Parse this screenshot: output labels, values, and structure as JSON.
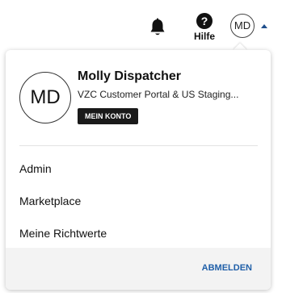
{
  "header": {
    "help_icon_glyph": "?",
    "help_label": "Hilfe",
    "avatar_initials": "MD",
    "icons": [
      "bell-icon",
      "help-icon",
      "caret-up-icon"
    ],
    "accent_color": "#1f4e8c"
  },
  "profile_menu": {
    "avatar_initials": "MD",
    "user_name": "Molly Dispatcher",
    "organization": "VZC Customer Portal & US Staging...",
    "account_button_label": "MEIN KONTO",
    "items": [
      {
        "label": "Admin"
      },
      {
        "label": "Marketplace"
      },
      {
        "label": "Meine Richtwerte"
      }
    ],
    "logout_label": "ABMELDEN",
    "logout_color": "#1f5fa8"
  }
}
